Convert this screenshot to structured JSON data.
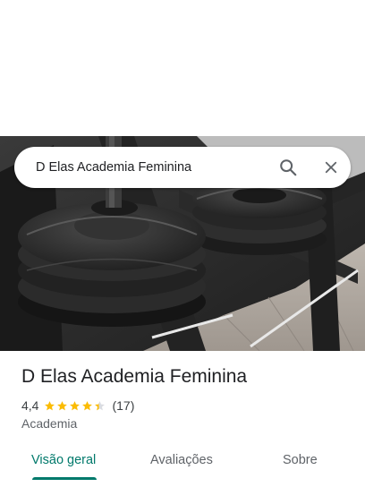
{
  "search": {
    "query": "D Elas Academia Feminina",
    "search_icon": "search-icon",
    "close_icon": "close-icon"
  },
  "place": {
    "name": "D Elas Academia Feminina",
    "rating": "4,4",
    "rating_numeric": 4.4,
    "reviews": "(17)",
    "category": "Academia"
  },
  "tabs": [
    {
      "label": "Visão geral",
      "active": true
    },
    {
      "label": "Avaliações",
      "active": false
    },
    {
      "label": "Sobre",
      "active": false
    }
  ],
  "colors": {
    "accent": "#00796b",
    "star": "#fbbc04",
    "text": "#202124",
    "secondary": "#5f6368"
  }
}
